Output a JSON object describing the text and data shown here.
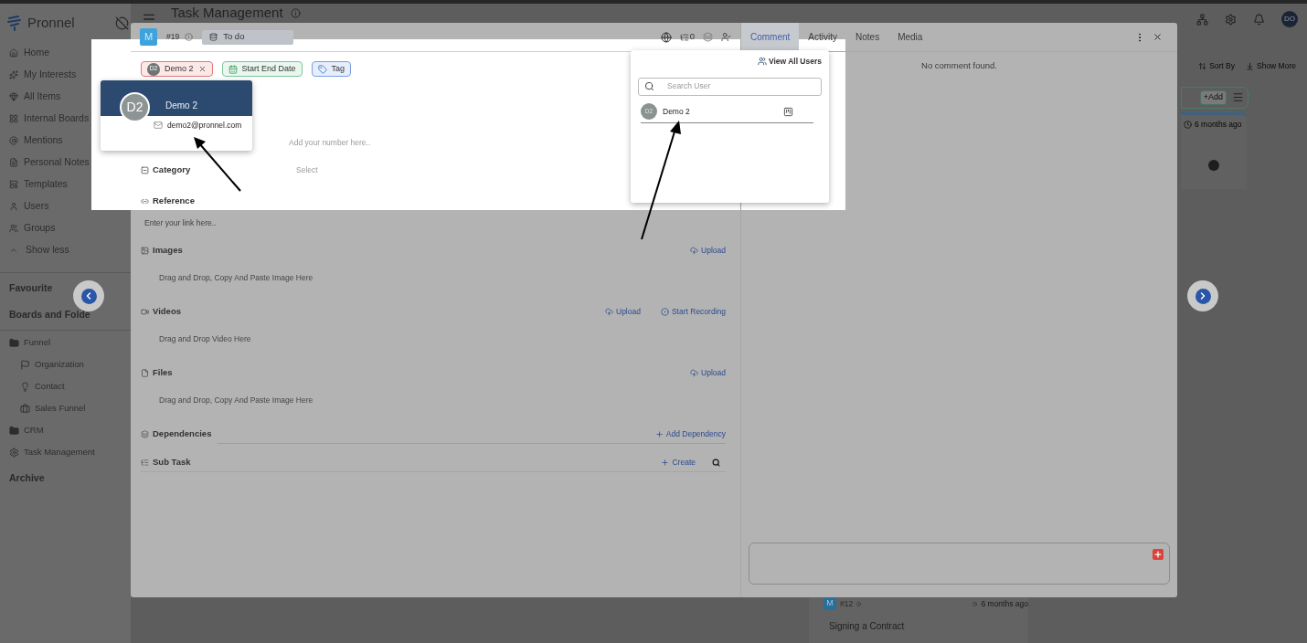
{
  "app": {
    "brand": "Pronnel",
    "title": "Task Management",
    "user_avatar": "DO"
  },
  "sidebar": {
    "items": [
      {
        "label": "Home"
      },
      {
        "label": "My Interests"
      },
      {
        "label": "All Items"
      },
      {
        "label": "Internal Boards"
      },
      {
        "label": "Mentions"
      },
      {
        "label": "Personal Notes"
      },
      {
        "label": "Templates"
      },
      {
        "label": "Users"
      },
      {
        "label": "Groups"
      }
    ],
    "toggle": "Show less",
    "favourite": "Favourite",
    "boards_heading": "Boards and Folde",
    "boards": [
      {
        "kind": "folder",
        "label": "Funnel",
        "children": [
          {
            "kind": "flag",
            "label": "Organization"
          },
          {
            "kind": "bulb",
            "label": "Contact"
          },
          {
            "kind": "case",
            "label": "Sales Funnel"
          }
        ]
      },
      {
        "kind": "folder",
        "label": "CRM"
      },
      {
        "kind": "board",
        "label": "Task Management"
      }
    ],
    "archive": "Archive"
  },
  "background": {
    "toolbar": [
      "Sort By",
      "Show More"
    ],
    "add_button": "+Add",
    "card_time": "6 months ago",
    "task_card": {
      "avatar": "M",
      "number": "#12",
      "time": "6 months ago",
      "title": "Signing a Contract"
    }
  },
  "task": {
    "avatar": "M",
    "number": "#19",
    "status": "To do",
    "subtask_count": "0",
    "chips": [
      {
        "kind": "user",
        "avatar": "D2",
        "label": "Demo 2"
      },
      {
        "kind": "date",
        "label": "Start End Date"
      },
      {
        "kind": "tag",
        "label": "Tag"
      }
    ],
    "number_placeholder": "Add your number here..",
    "category": {
      "label": "Category",
      "placeholder": "Select"
    },
    "reference": {
      "label": "Reference",
      "placeholder": "Enter your link here.."
    },
    "sections": [
      {
        "kind": "images",
        "label": "Images",
        "hint": "Drag and Drop, Copy And Paste Image Here",
        "actions": [
          {
            "kind": "upload",
            "label": "Upload"
          }
        ]
      },
      {
        "kind": "videos",
        "label": "Videos",
        "hint": "Drag and Drop Video Here",
        "actions": [
          {
            "kind": "upload",
            "label": "Upload"
          },
          {
            "kind": "record",
            "label": "Start Recording"
          }
        ]
      },
      {
        "kind": "files",
        "label": "Files",
        "hint": "Drag and Drop, Copy And Paste Image Here",
        "actions": [
          {
            "kind": "upload",
            "label": "Upload"
          }
        ]
      }
    ],
    "dependencies": {
      "label": "Dependencies",
      "action": "Add Dependency"
    },
    "subtask": {
      "label": "Sub Task",
      "action": "Create"
    }
  },
  "tabs": [
    {
      "label": "Comment",
      "selected": true
    },
    {
      "label": "Activity",
      "selected": false
    },
    {
      "label": "Notes",
      "selected": false
    },
    {
      "label": "Media",
      "selected": false
    }
  ],
  "comments": {
    "empty": "No comment found."
  },
  "user_card": {
    "avatar": "D2",
    "name": "Demo 2",
    "email": "demo2@pronnel.com"
  },
  "user_menu": {
    "view_all": "View All Users",
    "search_placeholder": "Search User",
    "users": [
      {
        "avatar": "D2",
        "name": "Demo 2"
      }
    ]
  }
}
